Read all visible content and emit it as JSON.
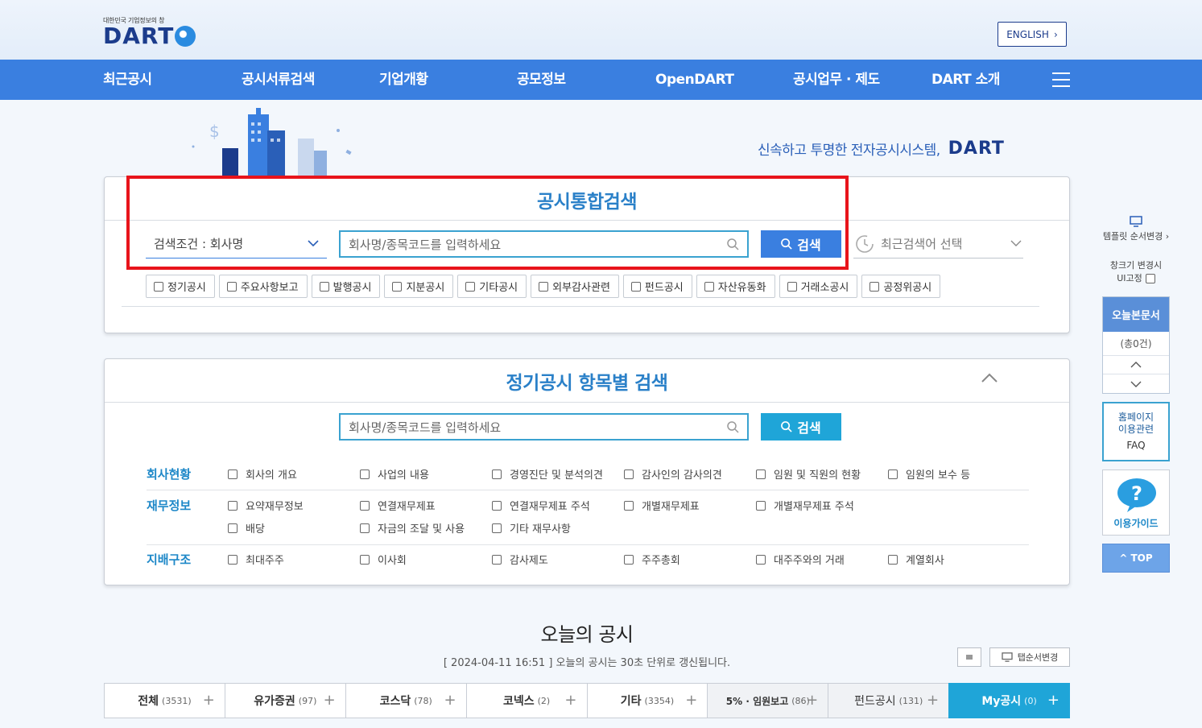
{
  "header": {
    "logo_sub": "대한민국 기업정보의 창",
    "logo_text": "DART",
    "english_label": "ENGLISH"
  },
  "nav": {
    "items": [
      "최근공시",
      "공시서류검색",
      "기업개황",
      "공모정보",
      "OpenDART",
      "공시업무 · 제도",
      "DART 소개"
    ]
  },
  "hero": {
    "slogan": "신속하고 투명한 전자공시시스템,",
    "slogan_brand": "DART"
  },
  "integrated_search": {
    "title": "공시통합검색",
    "condition_label": "검색조건 : 회사명",
    "input_placeholder": "회사명/종목코드를 입력하세요",
    "search_button": "검색",
    "recent_label": "최근검색어 선택",
    "filters": [
      "정기공시",
      "주요사항보고",
      "발행공시",
      "지분공시",
      "기타공시",
      "외부감사관련",
      "펀드공시",
      "자산유동화",
      "거래소공시",
      "공정위공시"
    ]
  },
  "item_search": {
    "title": "정기공시 항목별 검색",
    "input_placeholder": "회사명/종목코드를 입력하세요",
    "search_button": "검색",
    "categories": [
      {
        "label": "회사현황",
        "options": [
          "회사의 개요",
          "사업의 내용",
          "경영진단 및 분석의견",
          "감사인의 감사의견",
          "임원 및 직원의 현황",
          "임원의 보수 등"
        ]
      },
      {
        "label": "재무정보",
        "options": [
          "요약재무정보",
          "연결재무제표",
          "연결재무제표 주석",
          "개별재무제표",
          "개별재무제표 주석",
          "배당",
          "자금의 조달 및 사용",
          "기타 재무사항"
        ]
      },
      {
        "label": "지배구조",
        "options": [
          "최대주주",
          "이사회",
          "감사제도",
          "주주총회",
          "대주주와의 거래",
          "계열회사"
        ]
      }
    ]
  },
  "sidebar": {
    "template_label": "템플릿 순서변경",
    "fix_label_1": "창크기 변경시",
    "fix_label_2": "UI고정",
    "today_docs": "오늘본문서",
    "today_count": "(총0건)",
    "faq_1": "홈페이지",
    "faq_2": "이용관련",
    "faq_3": "FAQ",
    "guide": "이용가이드",
    "top": "TOP"
  },
  "today": {
    "title": "오늘의 공시",
    "subtitle": "[ 2024-04-11 16:51 ] 오늘의 공시는 30초 단위로 갱신됩니다.",
    "tab_order_btn": "탭순서변경",
    "tabs": [
      {
        "label": "전체",
        "count": "(3531)"
      },
      {
        "label": "유가증권",
        "count": "(97)"
      },
      {
        "label": "코스닥",
        "count": "(78)"
      },
      {
        "label": "코넥스",
        "count": "(2)"
      },
      {
        "label": "기타",
        "count": "(3354)"
      },
      {
        "label": "5% · 임원보고",
        "count": "(86)"
      },
      {
        "label": "펀드공시",
        "count": "(131)"
      },
      {
        "label": "My공시",
        "count": "(0)"
      }
    ]
  },
  "colors": {
    "nav": "#3a7fe0",
    "accent": "#1fa5d8",
    "highlight": "#e8141b"
  }
}
